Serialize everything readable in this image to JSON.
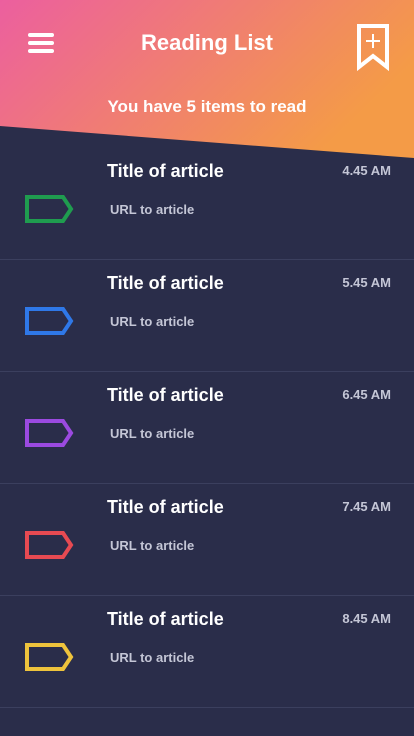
{
  "header": {
    "title": "Reading List",
    "subtitle": "You have 5 items to read",
    "gradient_start": "#ec5f9f",
    "gradient_end": "#f49b47",
    "menu_icon": "hamburger-menu-icon",
    "bookmark_icon": "bookmark-add-icon"
  },
  "items": [
    {
      "title": "Title of article",
      "url": "URL to article",
      "time": "4.45 AM",
      "tag_color": "#1f9c4f",
      "icon": "tag-icon"
    },
    {
      "title": "Title of article",
      "url": "URL to article",
      "time": "5.45 AM",
      "tag_color": "#2f78e8",
      "icon": "tag-icon"
    },
    {
      "title": "Title of article",
      "url": "URL to article",
      "time": "6.45 AM",
      "tag_color": "#9b4ae0",
      "icon": "tag-icon"
    },
    {
      "title": "Title of article",
      "url": "URL to article",
      "time": "7.45 AM",
      "tag_color": "#e74a52",
      "icon": "tag-icon"
    },
    {
      "title": "Title of article",
      "url": "URL to article",
      "time": "8.45 AM",
      "tag_color": "#eec33c",
      "icon": "tag-icon"
    }
  ],
  "colors": {
    "background": "#2a2d4a",
    "text_primary": "#ffffff",
    "text_secondary": "#c4c6d6"
  }
}
